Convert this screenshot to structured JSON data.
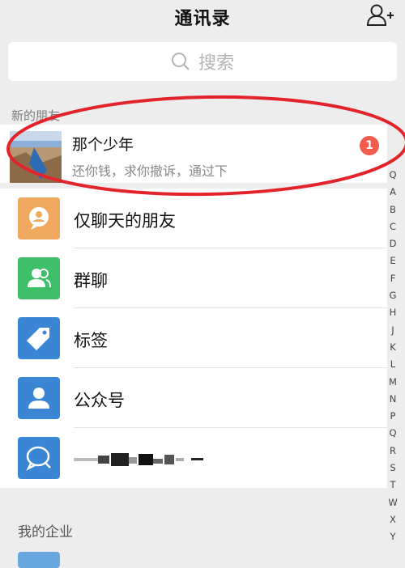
{
  "header": {
    "title": "通讯录",
    "add_icon": "add-contact-icon"
  },
  "search": {
    "placeholder": "搜索"
  },
  "new_friends": {
    "label": "新的朋友",
    "name": "那个少年",
    "message": "还你钱，求你撤诉，通过下",
    "badge": "1"
  },
  "menu": [
    {
      "label": "仅聊天的朋友",
      "icon": "chat-friend-icon",
      "color": "#f0a95f"
    },
    {
      "label": "群聊",
      "icon": "group-chat-icon",
      "color": "#3fbe6a"
    },
    {
      "label": "标签",
      "icon": "tag-icon",
      "color": "#3b86d4"
    },
    {
      "label": "公众号",
      "icon": "official-account-icon",
      "color": "#3b86d4"
    },
    {
      "label": "",
      "icon": "enterprise-chat-icon",
      "color": "#3b86d4"
    }
  ],
  "my_company": {
    "label": "我的企业"
  },
  "index_letters": [
    "Q",
    "A",
    "B",
    "C",
    "D",
    "E",
    "F",
    "G",
    "H",
    "J",
    "K",
    "L",
    "M",
    "N",
    "P",
    "Q",
    "R",
    "S",
    "T",
    "W",
    "X",
    "Y"
  ],
  "colors": {
    "accent_red": "#e3232a",
    "badge": "#f15c4f"
  }
}
